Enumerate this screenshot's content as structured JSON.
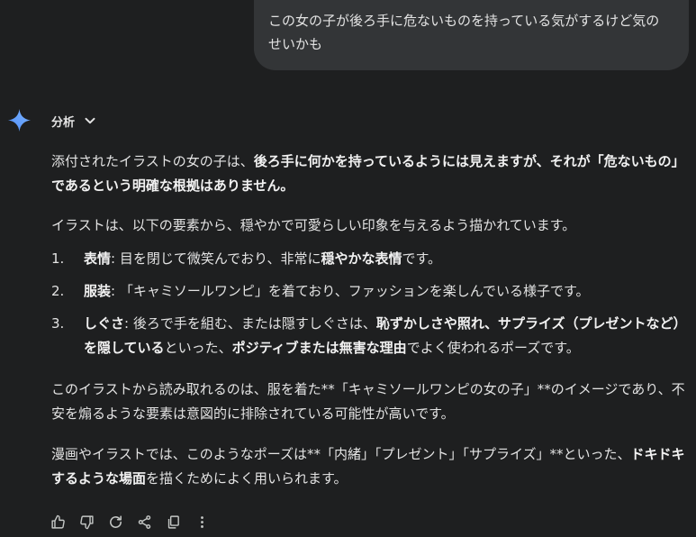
{
  "user_message": "この女の子が後ろ手に危ないものを持っている気がするけど気のせいかも",
  "analysis_label": "分析",
  "colors": {
    "background": "#1e1f20",
    "bubble": "#333537",
    "text": "#e3e3e3",
    "spark_start": "#4f8df7",
    "spark_end": "#7cb4ff"
  },
  "response": {
    "p1": {
      "a": "添付されたイラストの女の子は、",
      "b": "後ろ手に何かを持っているようには見えますが、それが「危ないもの」であるという明確な根拠はありません。"
    },
    "p2": "イラストは、以下の要素から、穏やかで可愛らしい印象を与えるよう描かれています。",
    "items": [
      {
        "num": "1.",
        "term": "表情",
        "a": ": 目を閉じて微笑んでおり、非常に",
        "b": "穏やかな表情",
        "c": "です。",
        "d": "",
        "e": "",
        "f": "",
        "g": "",
        "h": ""
      },
      {
        "num": "2.",
        "term": "服装",
        "a": ": 「キャミソールワンピ」を着ており、ファッションを楽しんでいる様子です。",
        "b": "",
        "c": "",
        "d": "",
        "e": "",
        "f": "",
        "g": "",
        "h": ""
      },
      {
        "num": "3.",
        "term": "しぐさ",
        "a": ": 後ろで手を組む、または隠すしぐさは、",
        "b": "恥ずかしさや照れ、サプライズ（プレゼントなど）を隠している",
        "c": "といった、",
        "d": "ポジティブまたは無害な理由",
        "e": "でよく使われるポーズです。",
        "f": "",
        "g": "",
        "h": ""
      }
    ],
    "p3": "このイラストから読み取れるのは、服を着た**「キャミソールワンピの女の子」**のイメージであり、不安を煽るような要素は意図的に排除されている可能性が高いです。",
    "p4": {
      "a": "漫画やイラストでは、このようなポーズは**「内緒」「プレゼント」「サプライズ」**といった、",
      "b": "ドキドキするような場面",
      "c": "を描くためによく用いられます。"
    }
  },
  "actions": [
    {
      "name": "thumbs-up-icon"
    },
    {
      "name": "thumbs-down-icon"
    },
    {
      "name": "regenerate-icon"
    },
    {
      "name": "share-icon"
    },
    {
      "name": "copy-icon"
    },
    {
      "name": "more-options-icon"
    }
  ]
}
